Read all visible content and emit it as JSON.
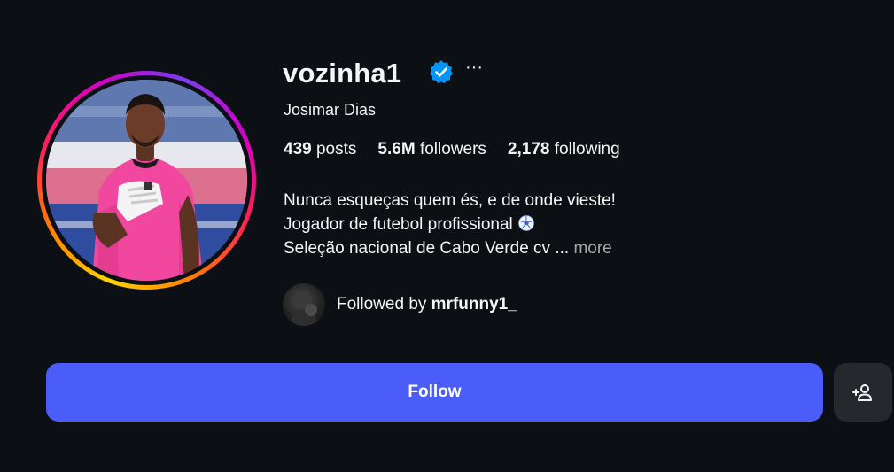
{
  "profile": {
    "username": "vozinha1",
    "full_name": "Josimar Dias",
    "more_label": "···",
    "stats": {
      "posts_count": "439",
      "posts_label": "posts",
      "followers_count": "5.6M",
      "followers_label": "followers",
      "following_count": "2,178",
      "following_label": "following"
    },
    "bio": {
      "line1": "Nunca esqueças quem és, e de onde vieste!",
      "line2": "Jogador de futebol profissional",
      "line3": "Seleção nacional de Cabo Verde cv",
      "ellipsis": " ... ",
      "more_link": "more"
    },
    "followed_by": {
      "prefix": "Followed by ",
      "user": "mrfunny1_"
    }
  },
  "actions": {
    "follow_label": "Follow"
  },
  "icons": {
    "verified": "verified-badge-icon",
    "more": "more-options-icon",
    "soccer_ball": "soccer-ball-icon",
    "suggest": "add-person-icon"
  },
  "colors": {
    "background": "#0c0f14",
    "follow_button": "#4a5df9",
    "verified_blue": "#0095f6",
    "secondary_text": "#a8a8a8",
    "icon_button": "#25292e"
  }
}
